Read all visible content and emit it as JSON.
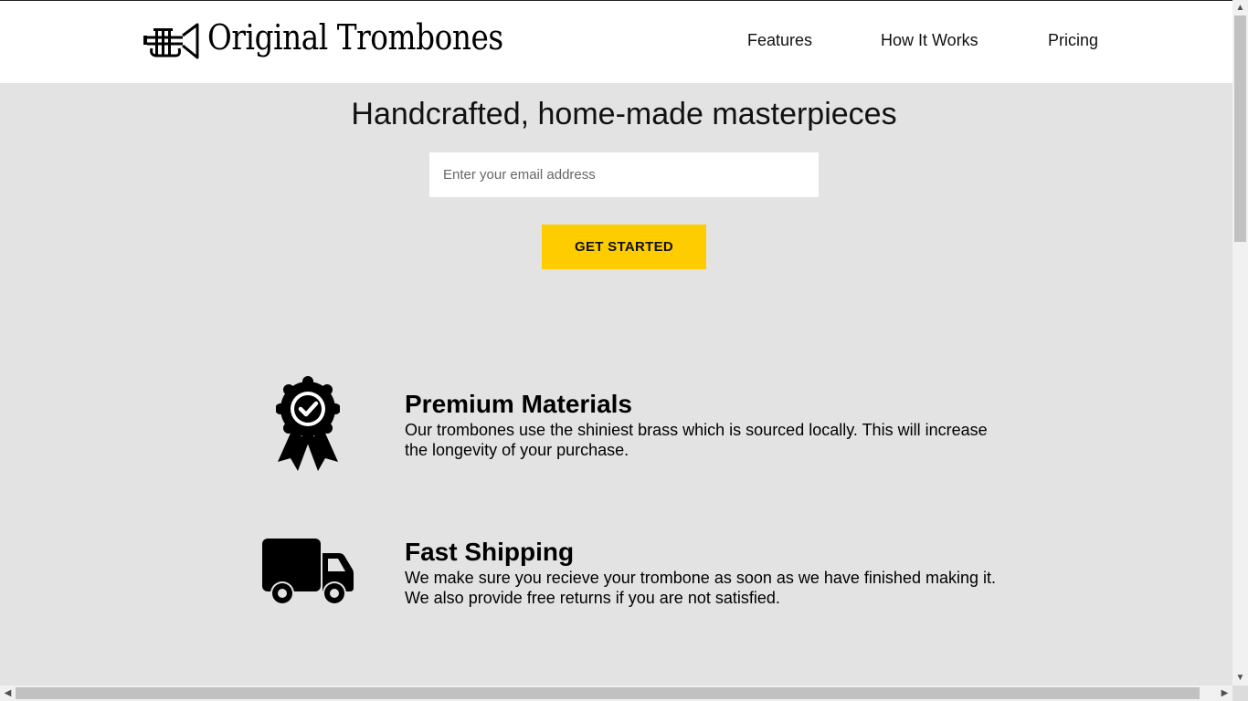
{
  "header": {
    "brand": "Original Trombones",
    "logo_icon": "trumpet-icon",
    "nav": [
      {
        "label": "Features"
      },
      {
        "label": "How It Works"
      },
      {
        "label": "Pricing"
      }
    ]
  },
  "hero": {
    "title": "Handcrafted, home-made masterpieces",
    "email_placeholder": "Enter your email address",
    "email_value": "",
    "cta_label": "GET STARTED"
  },
  "features": [
    {
      "icon": "award-ribbon-icon",
      "title": "Premium Materials",
      "text": "Our trombones use the shiniest brass which is sourced locally. This will increase the longevity of your purchase."
    },
    {
      "icon": "delivery-truck-icon",
      "title": "Fast Shipping",
      "text": "We make sure you recieve your trombone as soon as we have finished making it. We also provide free returns if you are not satisfied."
    }
  ],
  "colors": {
    "accent": "#ffcc00",
    "background": "#e3e3e3",
    "header_bg": "#ffffff"
  }
}
